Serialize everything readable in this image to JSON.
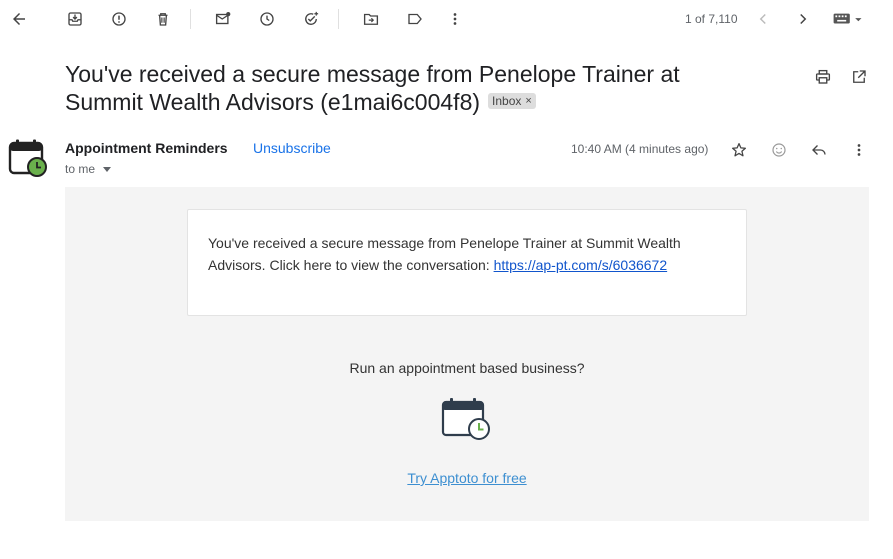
{
  "toolbar": {
    "icons": [
      "back-arrow-icon",
      "archive-icon",
      "report-spam-icon",
      "delete-icon",
      "mark-unread-icon",
      "snooze-icon",
      "add-task-icon",
      "move-to-icon",
      "label-icon",
      "more-vert-icon"
    ],
    "pager_text": "1 of 7,110"
  },
  "email": {
    "subject": "You've received a secure message from Penelope Trainer at Summit Wealth Advisors (e1mai6c004f8)",
    "label": "Inbox",
    "label_remove": "×",
    "sender_name": "Appointment Reminders",
    "unsubscribe": "Unsubscribe",
    "recipient": "to me",
    "timestamp": "10:40 AM (4 minutes ago)",
    "body_text": "You've received a secure message from Penelope Trainer at Summit Wealth Advisors. Click here to view the conversation: ",
    "body_link": "https://ap-pt.com/s/6036672",
    "promo_text": "Run an appointment based business?",
    "promo_link": "Try Apptoto for free"
  },
  "colors": {
    "link": "#1a73e8",
    "body_bg": "#f4f4f4",
    "avatar_green": "#6ab04c"
  }
}
